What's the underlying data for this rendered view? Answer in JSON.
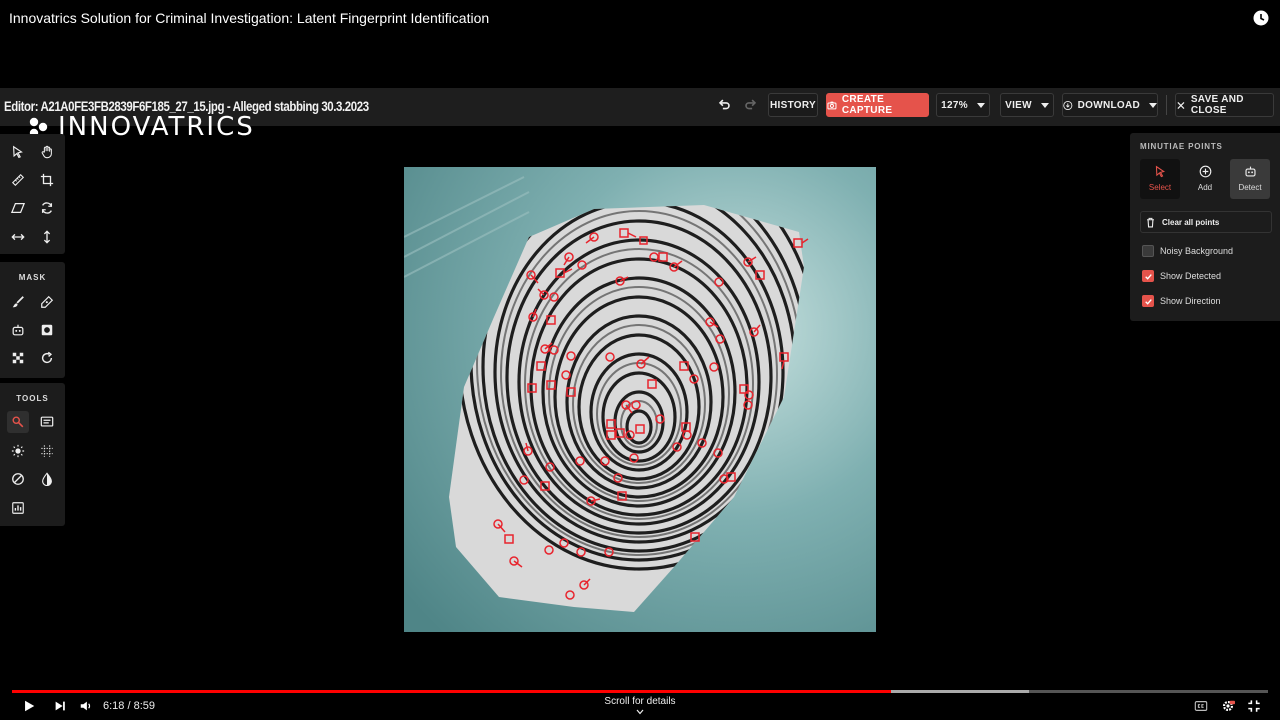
{
  "video": {
    "title": "Innovatrics Solution for Criminal Investigation: Latent Fingerprint Identification",
    "time_display": "6:18 / 8:59",
    "scroll_hint": "Scroll for details",
    "progress_fraction": 0.7,
    "buffer_fraction": 0.81
  },
  "editor": {
    "title": "Editor: A21A0FE3FB2839F6F185_27_15.jpg - Alleged stabbing 30.3.2023",
    "toolbar": {
      "history_label": "HISTORY",
      "create_capture_label": "CREATE CAPTURE",
      "zoom_label": "127%",
      "view_label": "VIEW",
      "download_label": "DOWNLOAD",
      "save_close_label": "SAVE AND CLOSE"
    }
  },
  "logo": {
    "text": "INNOVATRICS"
  },
  "left_panels": {
    "mask_label": "MASK",
    "tools_label": "TOOLS"
  },
  "minutiae": {
    "title": "MINUTIAE POINTS",
    "tools": {
      "select": "Select",
      "add": "Add",
      "detect": "Detect"
    },
    "clear_label": "Clear all points",
    "options": [
      {
        "label": "Noisy Background",
        "checked": false
      },
      {
        "label": "Show Detected",
        "checked": true
      },
      {
        "label": "Show Direction",
        "checked": true
      }
    ]
  },
  "colors": {
    "accent": "#e5534b",
    "progress": "#ff0000",
    "panel": "#1c1c1c"
  }
}
